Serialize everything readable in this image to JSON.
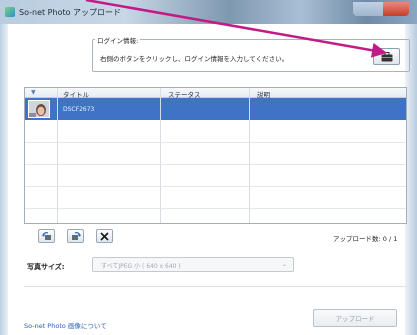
{
  "window": {
    "title": "So-net Photo アップロード"
  },
  "login": {
    "legend": "ログイン情報:",
    "instruction": "右側のボタンをクリックし、ログイン情報を入力してください。",
    "button_icon": "briefcase-icon"
  },
  "table": {
    "columns": [
      "タイトル",
      "ステータス",
      "説明"
    ],
    "rows": [
      {
        "title": "DSCF2673",
        "status": "",
        "description": ""
      }
    ]
  },
  "toolbar": {
    "rotate_left_icon": "rotate-left-icon",
    "rotate_right_icon": "rotate-right-icon",
    "delete_icon": "close-icon",
    "upload_count": "アップロード数: 0 / 1"
  },
  "photo_size": {
    "label": "写真サイズ:",
    "selected": "すべてJPEG 小 ( 640 x 640 )"
  },
  "footer": {
    "about_link": "So-net Photo 画像について",
    "upload_button": "アップロード"
  },
  "colors": {
    "selection": "#3f74c4",
    "annotation_arrow": "#c21b87",
    "link": "#2c5fb4"
  }
}
